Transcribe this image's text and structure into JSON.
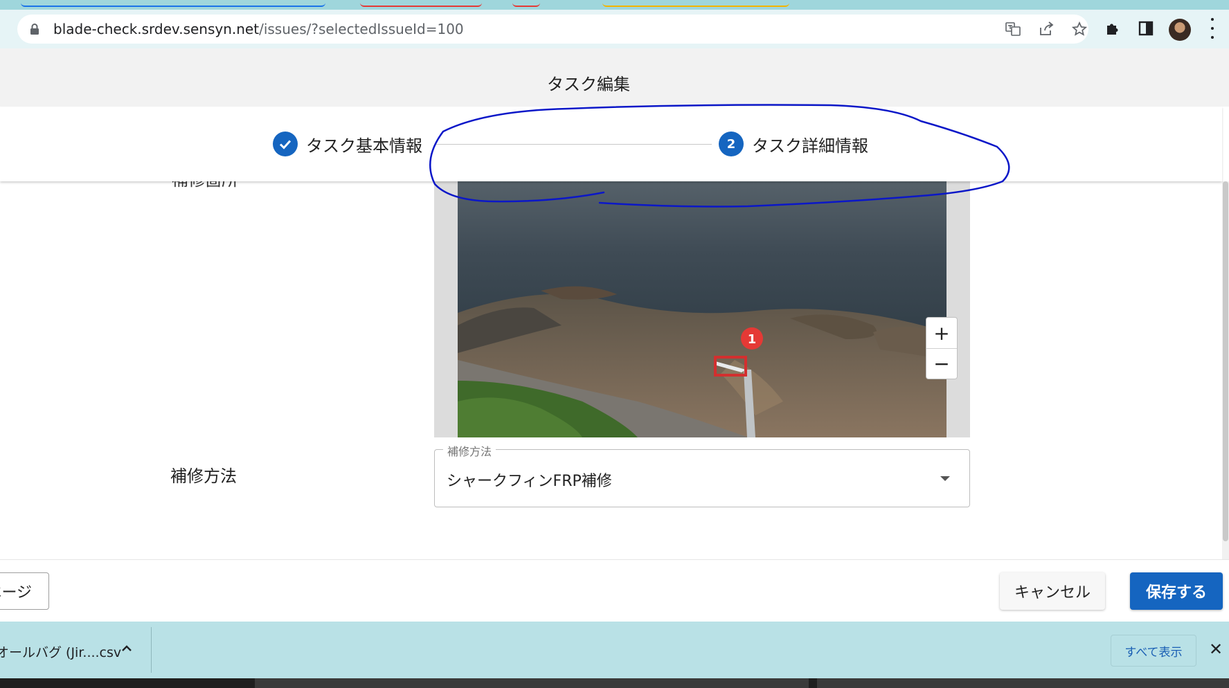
{
  "browser": {
    "url_host": "blade-check.srdev.sensyn.net",
    "url_path": "/issues/?selectedIssueId=100"
  },
  "dialog": {
    "title": "タスク編集"
  },
  "stepper": {
    "steps": [
      {
        "label": "タスク基本情報",
        "state": "completed"
      },
      {
        "number": "2",
        "label": "タスク詳細情報",
        "state": "active"
      }
    ]
  },
  "form": {
    "partial_label": "補修箇所",
    "image": {
      "marker_number": "1",
      "zoom_in_label": "+",
      "zoom_out_label": "−"
    },
    "repair_method": {
      "label": "補修方法",
      "legend": "補修方法",
      "value": "シャークフィンFRP補修"
    }
  },
  "footer": {
    "prev_label": "ページ",
    "cancel_label": "キャンセル",
    "save_label": "保存する"
  },
  "downloads": {
    "file_name": "オールバグ (Jir....csv",
    "show_all_label": "すべて表示",
    "close_label": "✕"
  },
  "colors": {
    "primary": "#1565c0",
    "marker": "#e53935",
    "annotation": "#0b17c8",
    "download_bar": "#b9e1e6"
  }
}
